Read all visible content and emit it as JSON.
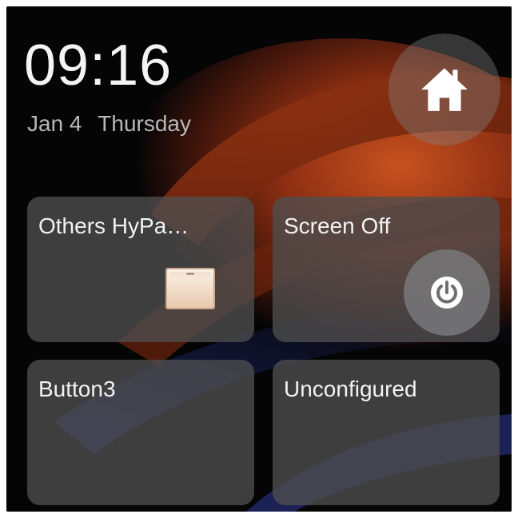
{
  "status": {
    "time": "09:16",
    "date": "Jan 4",
    "weekday": "Thursday"
  },
  "home_button": {
    "icon": "home-icon"
  },
  "tiles": [
    {
      "label": "Others HyPa…",
      "icon": "light-switch-icon"
    },
    {
      "label": "Screen Off",
      "icon": "power-icon"
    },
    {
      "label": "Button3"
    },
    {
      "label": "Unconfigured"
    }
  ],
  "colors": {
    "background": "#050506",
    "tile": "#4e4e50",
    "accent_wallpaper": "#c2471a",
    "text": "#ffffff"
  }
}
